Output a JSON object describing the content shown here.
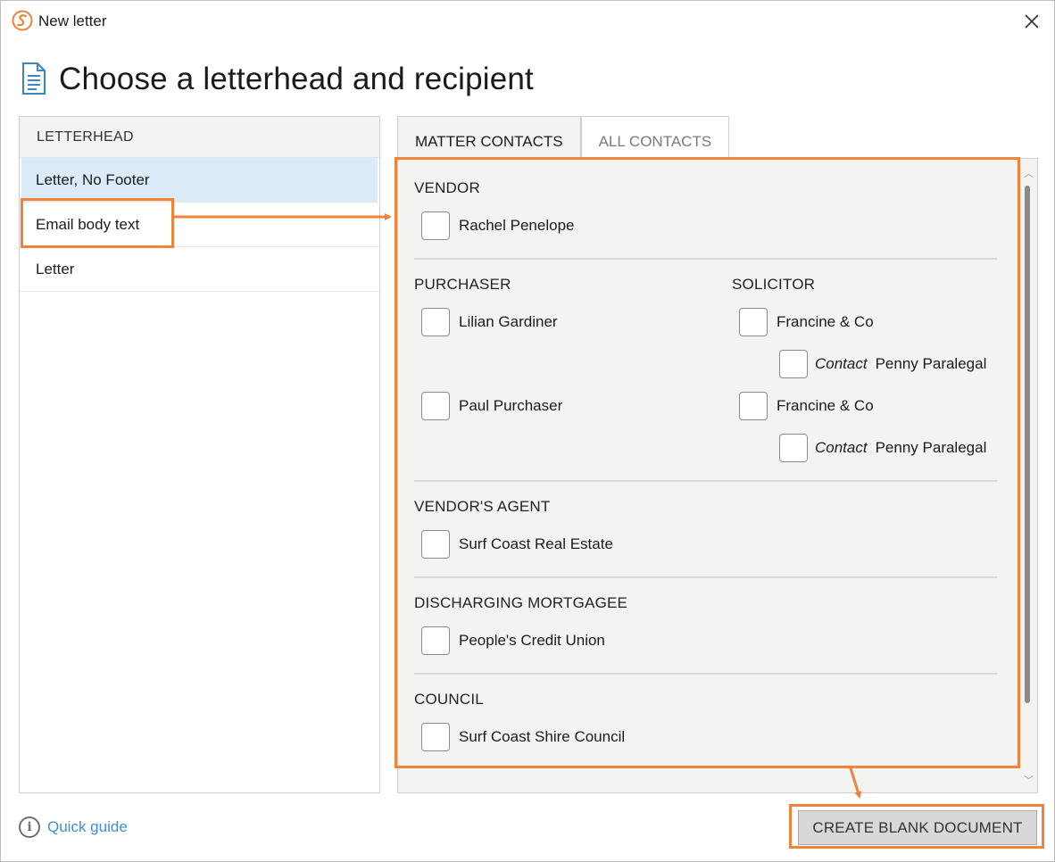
{
  "window": {
    "title": "New letter",
    "close_label": "✕"
  },
  "heading": "Choose a letterhead and recipient",
  "letterhead": {
    "header": "LETTERHEAD",
    "items": [
      "Letter, No Footer",
      "Email body text",
      "Letter"
    ],
    "selected_index": 0
  },
  "tabs": {
    "active": "MATTER CONTACTS",
    "inactive": "ALL CONTACTS"
  },
  "contacts": {
    "vendor": {
      "title": "VENDOR",
      "items": [
        "Rachel Penelope"
      ]
    },
    "purchaser": {
      "title": "PURCHASER",
      "items": [
        "Lilian Gardiner",
        "Paul Purchaser"
      ]
    },
    "solicitor": {
      "title": "SOLICITOR",
      "items": [
        {
          "name": "Francine & Co",
          "contact_label": "Contact",
          "contact_name": "Penny Paralegal"
        },
        {
          "name": "Francine & Co",
          "contact_label": "Contact",
          "contact_name": "Penny Paralegal"
        }
      ]
    },
    "vendors_agent": {
      "title": "VENDOR'S AGENT",
      "items": [
        "Surf Coast Real Estate"
      ]
    },
    "discharging_mortgagee": {
      "title": "DISCHARGING MORTGAGEE",
      "items": [
        "People's Credit Union"
      ]
    },
    "council": {
      "title": "COUNCIL",
      "items": [
        "Surf Coast Shire Council"
      ]
    }
  },
  "footer": {
    "quick_guide": "Quick guide",
    "create_button": "CREATE BLANK DOCUMENT"
  },
  "colors": {
    "callout": "#f0833a",
    "selected_row": "#dcebf9",
    "link": "#3f8fd2"
  }
}
